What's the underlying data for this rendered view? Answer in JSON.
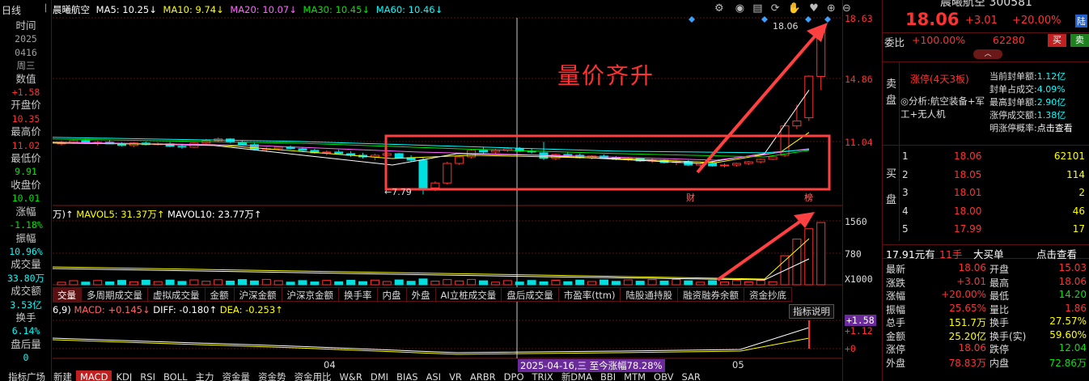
{
  "left_panel": {
    "period": "日线",
    "items": [
      {
        "label": "时间",
        "value": "2025",
        "value_color": "grey"
      },
      {
        "label": "",
        "value": "0416",
        "value_color": "grey"
      },
      {
        "label": "",
        "value": "周三",
        "value_color": "grey"
      },
      {
        "label": "数值",
        "value": "+1.58",
        "value_color": "red"
      },
      {
        "label": "开盘价",
        "value": "10.35",
        "value_color": "red"
      },
      {
        "label": "最高价",
        "value": "11.02",
        "value_color": "red"
      },
      {
        "label": "最低价",
        "value": "9.91",
        "value_color": "green"
      },
      {
        "label": "收盘价",
        "value": "10.01",
        "value_color": "green"
      },
      {
        "label": "涨幅",
        "value": "-1.18%",
        "value_color": "green"
      },
      {
        "label": "振幅",
        "value": "10.96%",
        "value_color": "cyan"
      },
      {
        "label": "成交量",
        "value": "33.80万",
        "value_color": "cyan"
      },
      {
        "label": "成交额",
        "value": "3.53亿",
        "value_color": "cyan"
      },
      {
        "label": "换手",
        "value": "6.14%",
        "value_color": "cyan"
      },
      {
        "label": "盘后量",
        "value": "0",
        "value_color": "cyan"
      }
    ]
  },
  "chart_header": {
    "stock_name": "晨曦航空",
    "ma5": "MA5: 10.25↓",
    "ma10": "MA10: 9.74↓",
    "ma20": "MA20: 10.07↓",
    "ma30": "MA30: 10.45↓",
    "ma60": "MA60: 10.46↓"
  },
  "price_axis": {
    "labels": [
      "18.63",
      "14.86",
      "11.04"
    ],
    "vol_labels": [
      "1560",
      "780",
      "X1000"
    ],
    "macd_labels": [
      "+1.58",
      "+1.12",
      "+0"
    ]
  },
  "annotation": {
    "text": "量价齐升",
    "low_label": "←7.79",
    "high_label": "18.06",
    "tag_cai": "财",
    "tag_bang": "榜"
  },
  "volume_header": {
    "prefix": "万)↑",
    "mavol5": "MAVOL5: 31.37万↑",
    "mavol10": "MAVOL10: 23.77万↑"
  },
  "indicator_tabs": [
    "交量",
    "多周期成交量",
    "虚拟成交量",
    "金额",
    "沪深金额",
    "沪深京金额",
    "换手率",
    "内盘",
    "外盘",
    "AI立桩成交量",
    "盘后成交量",
    "市盈率(ttm)",
    "陆股通持股",
    "融资融券余额",
    "资金抄底"
  ],
  "macd_header": {
    "prefix": "6,9)",
    "macd": "MACD: +0.145↓",
    "diff": "DIFF: -0.180↑",
    "dea": "DEA: -0.253↑",
    "help": "指标说明"
  },
  "date_axis": {
    "m04": "04",
    "m05": "05",
    "cursor_label": "2025-04-16,三 至今涨幅78.28%"
  },
  "bottom_tabs": [
    "指标广场",
    "新建",
    "MACD",
    "KDJ",
    "RSI",
    "BOLL",
    "主力",
    "资金量",
    "资金势",
    "资金用比",
    "W&R",
    "DMI",
    "BIAS",
    "ASI",
    "VR",
    "ARBR",
    "DPO",
    "TRIX",
    "新DMA",
    "BBI",
    "MTM",
    "OBV",
    "SAR"
  ],
  "right_panel": {
    "title": "晨曦航空 300581",
    "price": "18.06",
    "change": "+3.01",
    "pct": "+20.00%",
    "lu_tag": "陆",
    "webi_label": "委比",
    "webi_value": "+100.00%",
    "webi_vol": "62280",
    "buy_btn": "买",
    "sell_btn": "卖",
    "sell_side_label": "卖盘",
    "buy_side_label": "买盘",
    "zhangting": "涨停(4天3板)",
    "analysis": "◎分析:航空装备+军工+无人机",
    "stats": [
      {
        "label": "当前封单额:",
        "value": "1.12亿"
      },
      {
        "label": "封单占成交:",
        "value": "4.09%"
      },
      {
        "label": "最高封单额:",
        "value": "2.90亿"
      },
      {
        "label": "涨停成交额:",
        "value": "1.38亿"
      },
      {
        "label": "明涨停概率:",
        "value": "点击查看"
      }
    ],
    "bids": [
      {
        "level": "1",
        "price": "18.06",
        "vol": "62101"
      },
      {
        "level": "2",
        "price": "18.05",
        "vol": "114"
      },
      {
        "level": "3",
        "price": "18.01",
        "vol": "2"
      },
      {
        "level": "4",
        "price": "18.00",
        "vol": "46"
      },
      {
        "level": "5",
        "price": "17.99",
        "vol": "17"
      }
    ],
    "big_order": "17.91元有",
    "big_order_hands": "11手",
    "big_order_label": "大买单",
    "big_order_link": "点击查看",
    "quote_rows": [
      {
        "l1": "最新",
        "v1": "18.06",
        "c1": "red",
        "l2": "开盘",
        "v2": "15.03",
        "c2": "red"
      },
      {
        "l1": "涨跌",
        "v1": "+3.01",
        "c1": "red",
        "l2": "最高",
        "v2": "18.06",
        "c2": "red"
      },
      {
        "l1": "涨幅",
        "v1": "+20.00%",
        "c1": "red",
        "l2": "最低",
        "v2": "14.20",
        "c2": "green"
      },
      {
        "l1": "振幅",
        "v1": "25.65%",
        "c1": "red",
        "l2": "量比",
        "v2": "1.86",
        "c2": "red"
      },
      {
        "l1": "总手",
        "v1": "151.7万",
        "c1": "yellow",
        "l2": "换手",
        "v2": "27.57%",
        "c2": "yellow"
      },
      {
        "l1": "金额",
        "v1": "25.20亿",
        "c1": "yellow",
        "l2": "换手(实)",
        "v2": "59.60%",
        "c2": "yellow"
      },
      {
        "l1": "涨停",
        "v1": "18.06",
        "c1": "red",
        "l2": "跌停",
        "v2": "12.04",
        "c2": "green"
      },
      {
        "l1": "外盘",
        "v1": "78.83万",
        "c1": "red",
        "l2": "内盘",
        "v2": "72.86万",
        "c2": "green"
      }
    ]
  }
}
